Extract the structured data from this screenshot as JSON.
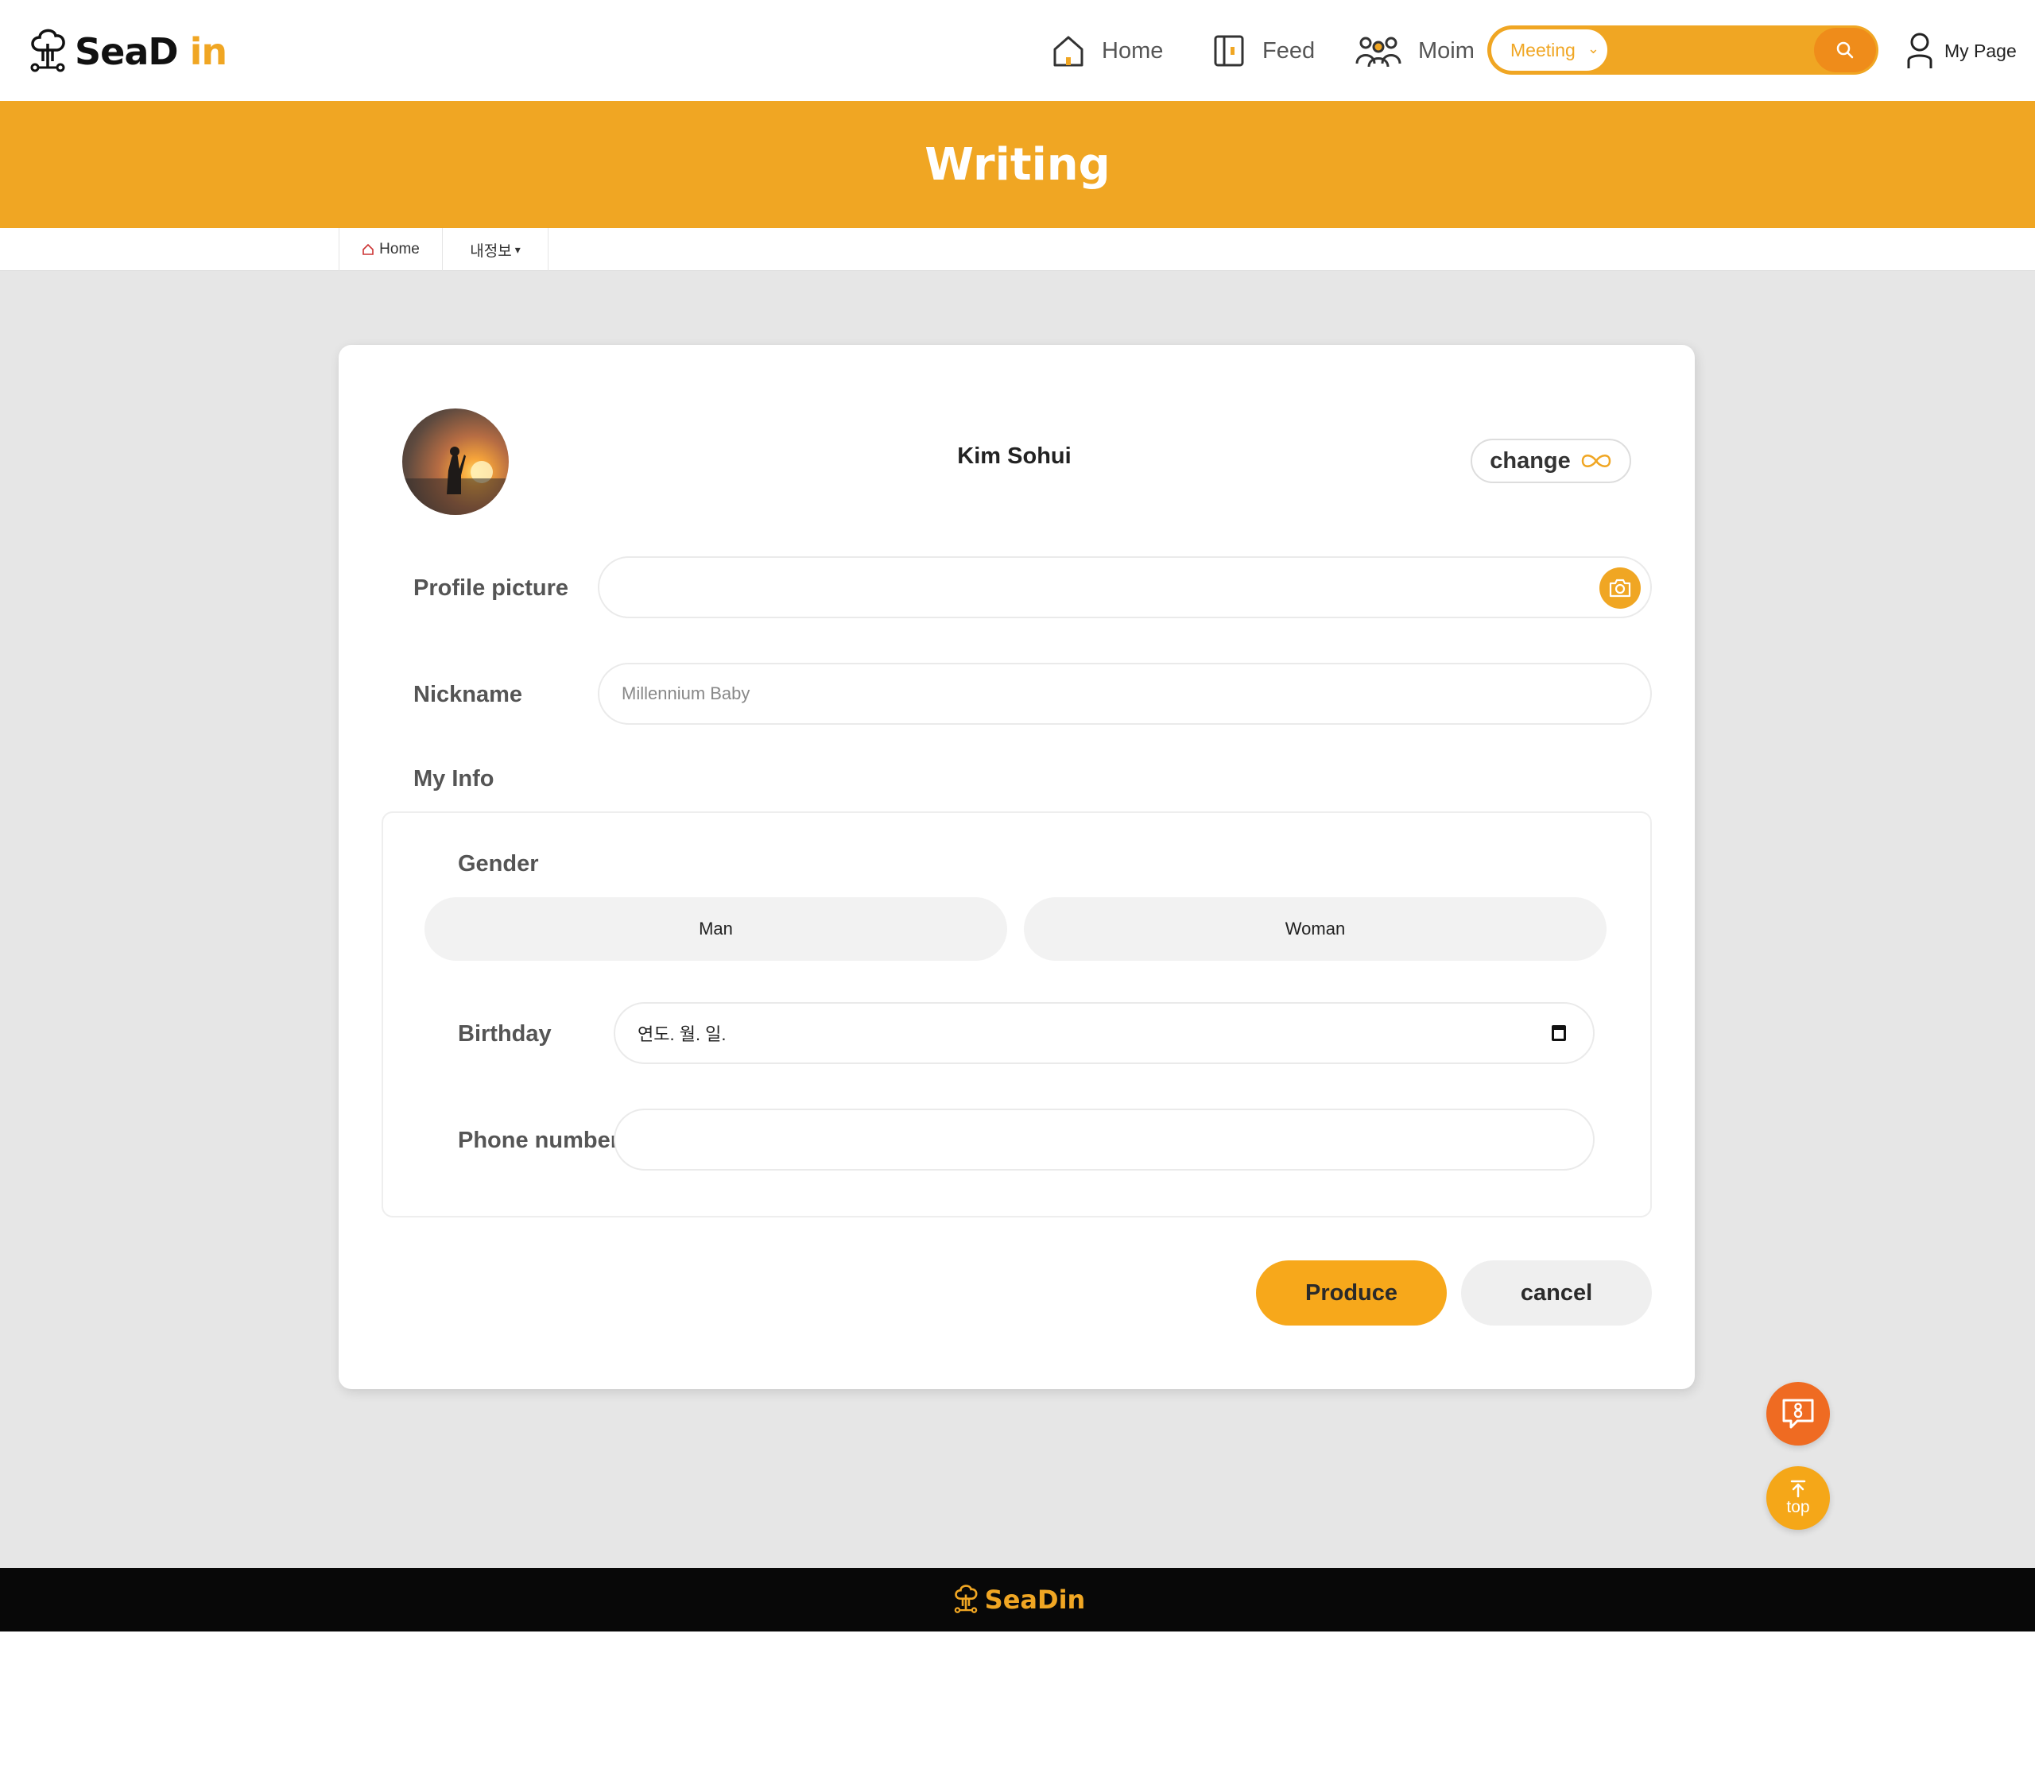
{
  "header": {
    "logo_main": "SeaD",
    "logo_accent": " in",
    "nav": [
      {
        "label": "Home",
        "icon": "home-icon"
      },
      {
        "label": "Feed",
        "icon": "feed-icon"
      },
      {
        "label": "Moim",
        "icon": "group-icon"
      }
    ],
    "search": {
      "category": "Meeting",
      "icon": "search-icon"
    },
    "mypage_label": "My Page"
  },
  "banner": {
    "title": "Writing"
  },
  "breadcrumb": {
    "home": "Home",
    "section": "내정보"
  },
  "profile": {
    "name": "Kim Sohui",
    "change_label": "change"
  },
  "form": {
    "profile_picture_label": "Profile picture",
    "nickname_label": "Nickname",
    "nickname_placeholder": "Millennium Baby",
    "my_info_label": "My Info",
    "gender_label": "Gender",
    "gender_options": [
      "Man",
      "Woman"
    ],
    "birthday_label": "Birthday",
    "birthday_value": "연도. 월. 일.",
    "phone_label": "Phone number",
    "produce_label": "Produce",
    "cancel_label": "cancel"
  },
  "floating": {
    "top_label": "top"
  },
  "footer": {
    "logo_main": "SeaD",
    "logo_accent": " in"
  },
  "colors": {
    "accent": "#f0a623",
    "accent_dark": "#ef8c1a",
    "chat_button": "#ef6b22",
    "footer_bg": "#080808"
  }
}
